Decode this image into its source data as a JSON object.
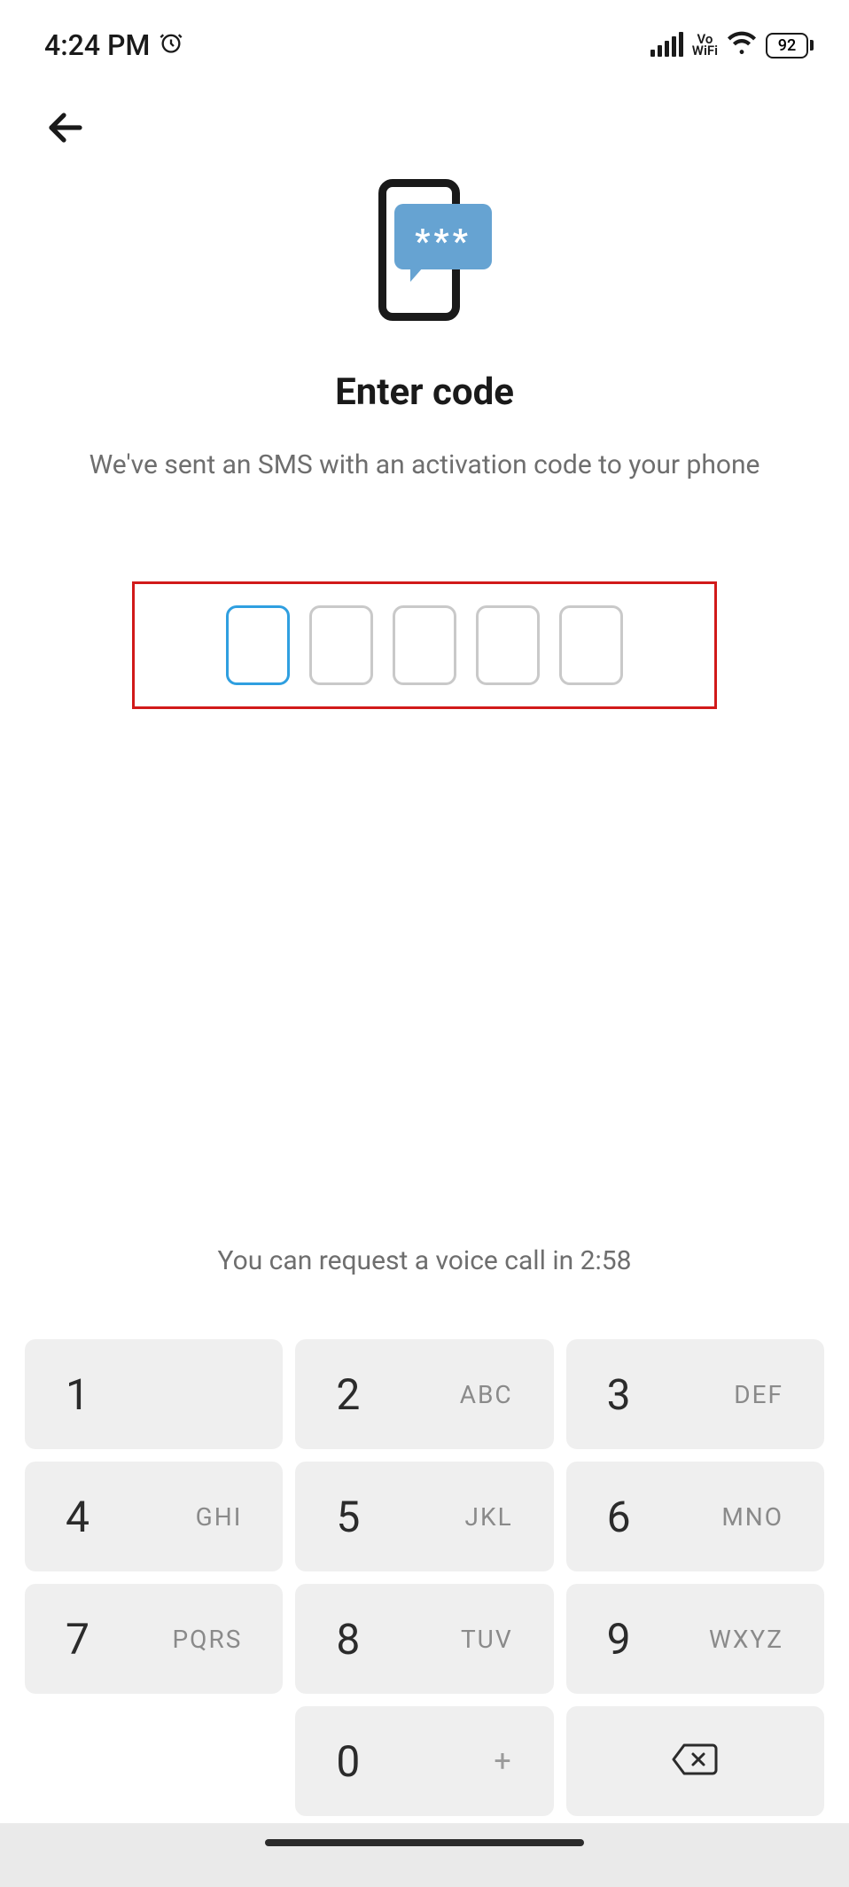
{
  "status": {
    "time": "4:24 PM",
    "vowifi_top": "Vo",
    "vowifi_bottom": "WiFi",
    "battery": "92"
  },
  "page": {
    "title": "Enter code",
    "subtitle": "We've sent an SMS with an activation code to your phone",
    "bubble_stars": "***",
    "voice_hint": "You can request a voice call in 2:58"
  },
  "code": {
    "length": 5,
    "active_index": 0,
    "values": [
      "",
      "",
      "",
      "",
      ""
    ]
  },
  "keypad": {
    "keys": [
      {
        "digit": "1",
        "letters": ""
      },
      {
        "digit": "2",
        "letters": "ABC"
      },
      {
        "digit": "3",
        "letters": "DEF"
      },
      {
        "digit": "4",
        "letters": "GHI"
      },
      {
        "digit": "5",
        "letters": "JKL"
      },
      {
        "digit": "6",
        "letters": "MNO"
      },
      {
        "digit": "7",
        "letters": "PQRS"
      },
      {
        "digit": "8",
        "letters": "TUV"
      },
      {
        "digit": "9",
        "letters": "WXYZ"
      }
    ],
    "zero": {
      "digit": "0",
      "letters": "+"
    }
  }
}
